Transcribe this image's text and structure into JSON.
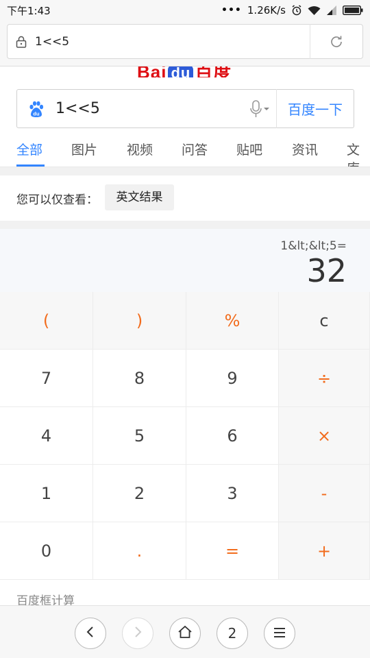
{
  "status_bar": {
    "time": "下午1:43",
    "dots": "•••",
    "speed": "1.26K/s"
  },
  "url_bar": {
    "url": "1<<5"
  },
  "logo": {
    "text_left": "Bai",
    "text_du": "du",
    "text_right": "百度"
  },
  "search": {
    "query": "1<<5",
    "button_label": "百度一下"
  },
  "tabs": [
    {
      "label": "全部"
    },
    {
      "label": "图片"
    },
    {
      "label": "视频"
    },
    {
      "label": "问答"
    },
    {
      "label": "贴吧"
    },
    {
      "label": "资讯"
    },
    {
      "label": "文库"
    }
  ],
  "filter": {
    "label": "您可以仅查看：",
    "chip": "英文结果"
  },
  "calculator": {
    "expression": "1&lt;&lt;5=",
    "result": "32",
    "keys": [
      [
        "(",
        ")",
        "%",
        "c"
      ],
      [
        "7",
        "8",
        "9",
        "÷"
      ],
      [
        "4",
        "5",
        "6",
        "×"
      ],
      [
        "1",
        "2",
        "3",
        "-"
      ],
      [
        "0",
        ".",
        "=",
        "+"
      ]
    ],
    "source_label": "百度框计算"
  },
  "bottom_nav": {
    "tab_count": "2"
  },
  "colors": {
    "accent_blue": "#3385ff",
    "operator_orange": "#f26c1d",
    "baidu_red": "#de0e13",
    "baidu_blue": "#2d5bd8"
  }
}
